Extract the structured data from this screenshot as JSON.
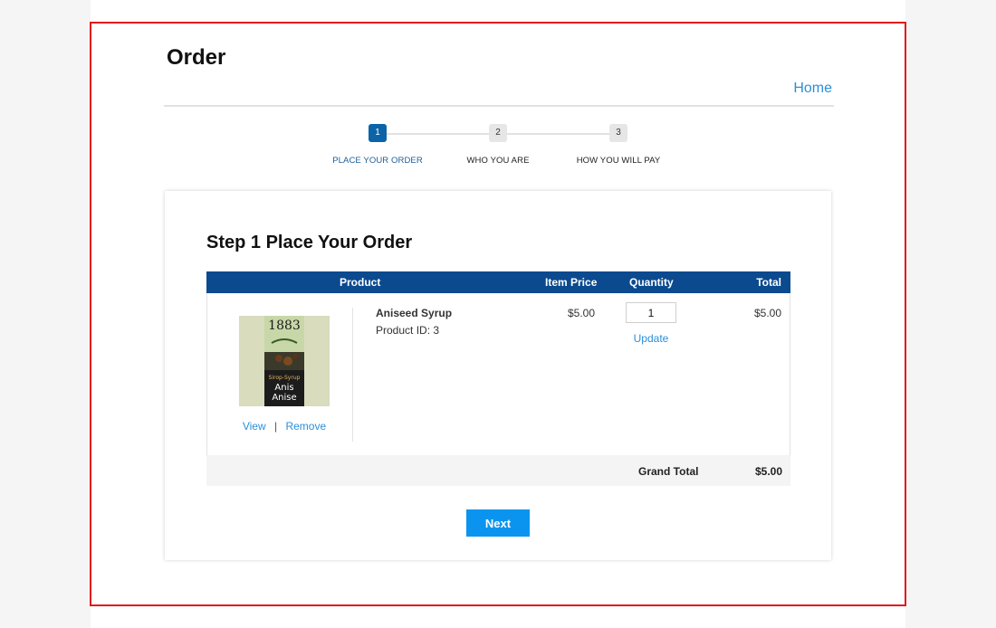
{
  "page": {
    "title": "Order",
    "home_link": "Home"
  },
  "stepper": {
    "steps": [
      {
        "number": "1",
        "label": "PLACE YOUR ORDER",
        "active": true
      },
      {
        "number": "2",
        "label": "WHO YOU ARE",
        "active": false
      },
      {
        "number": "3",
        "label": "HOW YOU WILL PAY",
        "active": false
      }
    ]
  },
  "order": {
    "heading": "Step 1 Place Your Order",
    "columns": {
      "product": "Product",
      "item_price": "Item Price",
      "quantity": "Quantity",
      "total": "Total"
    },
    "items": [
      {
        "name": "Aniseed Syrup",
        "product_id": "Product ID: 3",
        "image_alt": "aniseed-syrup-bottle-label",
        "image_text": {
          "year": "1883",
          "line1": "Sirop-Syrup",
          "line2": "Anis",
          "line3": "Anise"
        },
        "view_label": "View",
        "separator": "|",
        "remove_label": "Remove",
        "price": "$5.00",
        "quantity": "1",
        "update_label": "Update",
        "total": "$5.00"
      }
    ],
    "grand_total_label": "Grand Total",
    "grand_total_value": "$5.00",
    "next_label": "Next"
  },
  "colors": {
    "header_bg": "#0c4a8f",
    "active_step": "#0b63a8",
    "link": "#2b8fd9",
    "next_button": "#0a94f0",
    "frame_border": "#e0191c"
  }
}
